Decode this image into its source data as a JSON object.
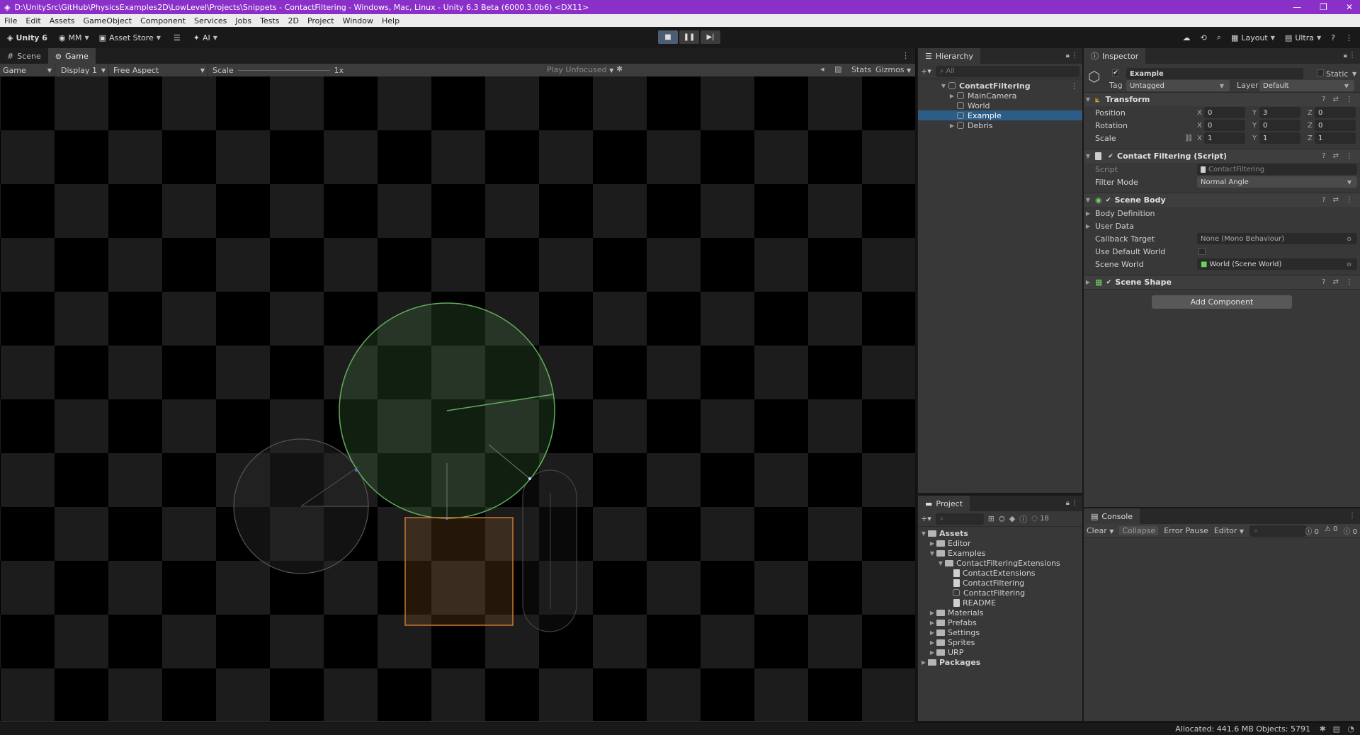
{
  "window": {
    "title": "D:\\UnitySrc\\GitHub\\PhysicsExamples2D\\LowLevel\\Projects\\Snippets - ContactFiltering - Windows, Mac, Linux - Unity 6.3 Beta (6000.3.0b6) <DX11>"
  },
  "menu": [
    "File",
    "Edit",
    "Assets",
    "GameObject",
    "Component",
    "Services",
    "Jobs",
    "Tests",
    "2D",
    "Project",
    "Window",
    "Help"
  ],
  "toolbar": {
    "unity": "Unity 6",
    "account": "MM",
    "asset_store": "Asset Store",
    "ai": "AI",
    "layout": "Layout",
    "quality": "Ultra"
  },
  "game": {
    "tabs": [
      "Scene",
      "Game"
    ],
    "mode": "Game",
    "display": "Display 1",
    "aspect": "Free Aspect",
    "scale_label": "Scale",
    "scale_value": "1x",
    "play_focus": "Play Unfocused",
    "stats": "Stats",
    "gizmos": "Gizmos"
  },
  "hierarchy": {
    "title": "Hierarchy",
    "search_placeholder": "All",
    "root": "ContactFiltering",
    "items": [
      "MainCamera",
      "World",
      "Example",
      "Debris"
    ]
  },
  "project": {
    "title": "Project",
    "badge": "18",
    "tree": [
      "Assets",
      "Editor",
      "Examples",
      "ContactFilteringExtensions",
      "ContactExtensions",
      "ContactFiltering",
      "ContactFiltering",
      "README",
      "Materials",
      "Prefabs",
      "Settings",
      "Sprites",
      "URP",
      "Packages"
    ]
  },
  "inspector": {
    "title": "Inspector",
    "object_name": "Example",
    "static_label": "Static",
    "tag_label": "Tag",
    "tag_value": "Untagged",
    "layer_label": "Layer",
    "layer_value": "Default",
    "transform": {
      "title": "Transform",
      "position_label": "Position",
      "position": [
        "0",
        "3",
        "0"
      ],
      "rotation_label": "Rotation",
      "rotation": [
        "0",
        "0",
        "0"
      ],
      "scale_label": "Scale",
      "scale": [
        "1",
        "1",
        "1"
      ]
    },
    "contact_filtering": {
      "title": "Contact Filtering (Script)",
      "script_label": "Script",
      "script_value": "ContactFiltering",
      "filter_label": "Filter Mode",
      "filter_value": "Normal Angle"
    },
    "scene_body": {
      "title": "Scene Body",
      "body_definition": "Body Definition",
      "user_data": "User Data",
      "callback_label": "Callback Target",
      "callback_value": "None (Mono Behaviour)",
      "use_default_world": "Use Default World",
      "scene_world_label": "Scene World",
      "scene_world_value": "World (Scene World)"
    },
    "scene_shape": {
      "title": "Scene Shape"
    },
    "add_component": "Add Component"
  },
  "console": {
    "title": "Console",
    "clear": "Clear",
    "collapse": "Collapse",
    "error_pause": "Error Pause",
    "editor": "Editor",
    "counts": [
      "0",
      "0",
      "0"
    ]
  },
  "status": {
    "text": "Allocated: 441.6 MB Objects: 5791"
  },
  "colors": {
    "title_bar": "#8b2fc9",
    "selection": "#2c5d87",
    "circle": "#5fae5a",
    "box": "#c87a2a"
  }
}
